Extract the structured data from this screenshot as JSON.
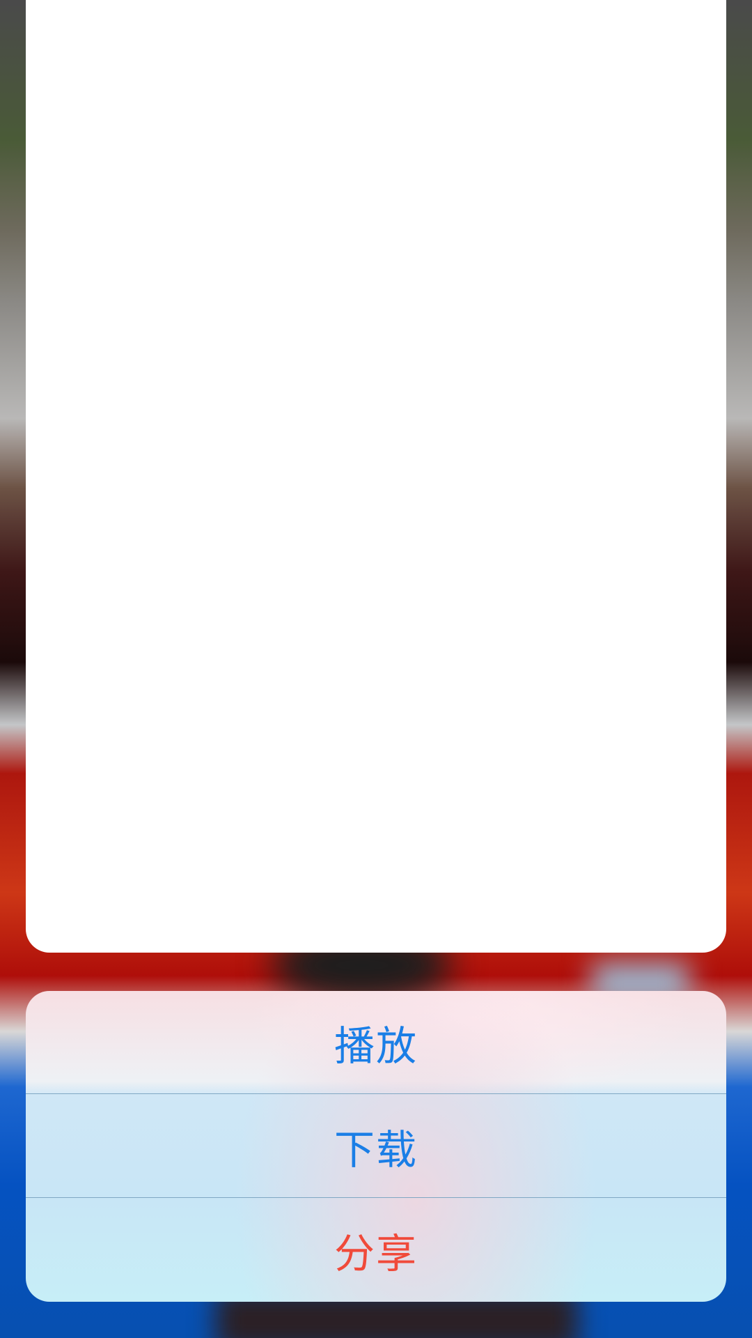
{
  "action_sheet": {
    "items": [
      {
        "label": "播放",
        "color": "#1a7ee6"
      },
      {
        "label": "下载",
        "color": "#1a7ee6"
      },
      {
        "label": "分享",
        "color": "#f04a3a"
      }
    ]
  },
  "colors": {
    "primary_action": "#1a7ee6",
    "destructive_action": "#f04a3a"
  }
}
